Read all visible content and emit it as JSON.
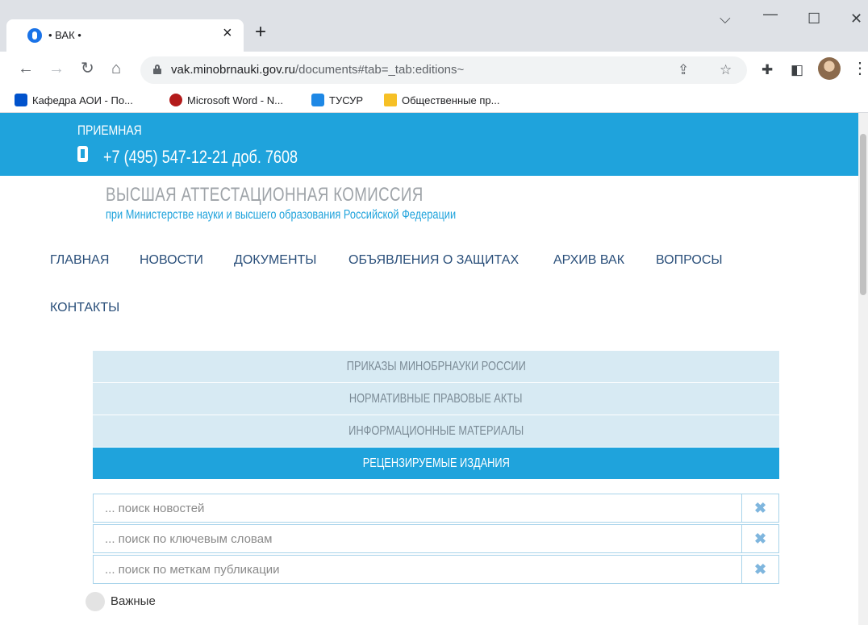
{
  "browser": {
    "tab_title": "• ВАК •",
    "close_tab": "×",
    "new_tab": "+",
    "url_host": "vak.minobrnauki.gov.ru",
    "url_path": "/documents#tab=_tab:editions~",
    "bookmarks": [
      {
        "label": "Кафедра АОИ - По...",
        "color": "#0052cc"
      },
      {
        "label": "Microsoft Word - N...",
        "color": "#b31b1b"
      },
      {
        "label": "ТУСУР",
        "color": "#1e88e5"
      },
      {
        "label": "Общественные пр...",
        "color": "#f6c026"
      }
    ]
  },
  "site": {
    "reception_label": "ПРИЕМНАЯ",
    "phone": "+7 (495) 547-12-21 доб. 7608",
    "title": "ВЫСШАЯ АТТЕСТАЦИОННАЯ КОМИССИЯ",
    "subtitle": "при Министерстве науки и высшего образования Российской Федерации",
    "accent_color": "#1fa3dc",
    "nav": [
      "ГЛАВНАЯ",
      "НОВОСТИ",
      "ДОКУМЕНТЫ",
      "ОБЪЯВЛЕНИЯ О ЗАЩИТАХ",
      "АРХИВ ВАК",
      "ВОПРОСЫ",
      "КОНТАКТЫ"
    ],
    "doc_tabs": [
      {
        "label": "ПРИКАЗЫ МИНОБРНАУКИ РОССИИ",
        "active": false
      },
      {
        "label": "НОРМАТИВНЫЕ ПРАВОВЫЕ АКТЫ",
        "active": false
      },
      {
        "label": "ИНФОРМАЦИОННЫЕ МАТЕРИАЛЫ",
        "active": false
      },
      {
        "label": "РЕЦЕНЗИРУЕМЫЕ ИЗДАНИЯ",
        "active": true
      }
    ],
    "search": {
      "news_placeholder": "... поиск новостей",
      "keywords_placeholder": "... поиск по ключевым словам",
      "tags_placeholder": "... поиск по меткам публикации",
      "clear_icon": "✖"
    },
    "important_label": "Важные"
  }
}
